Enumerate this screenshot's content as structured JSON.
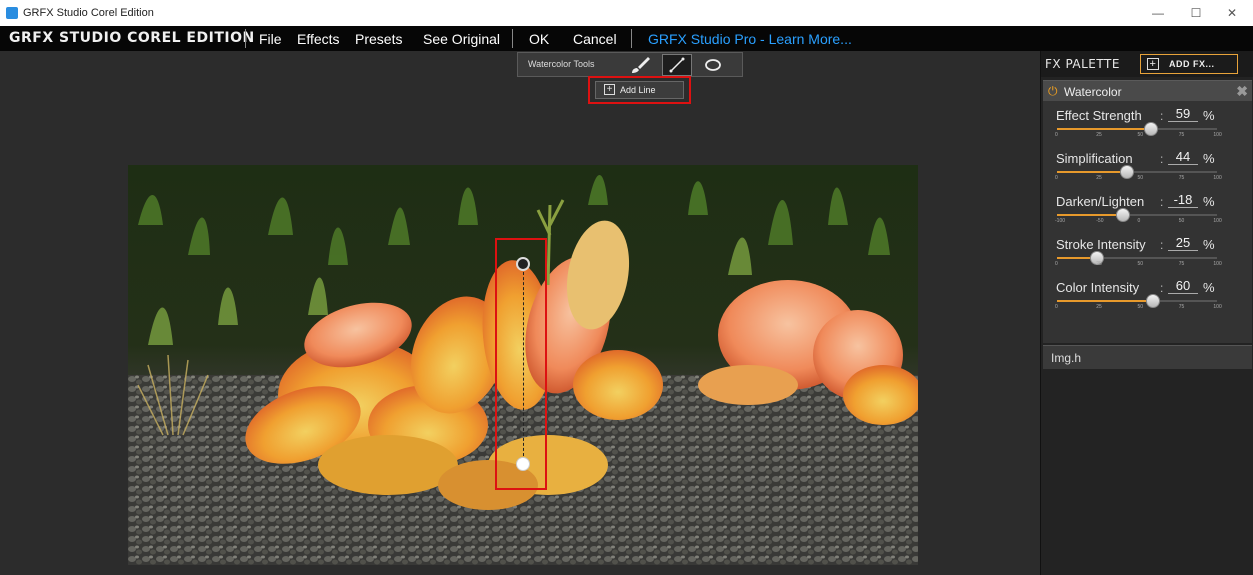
{
  "window": {
    "title": "GRFX Studio Corel Edition",
    "controls": [
      "—",
      "☐",
      "✕"
    ]
  },
  "menubar": {
    "logo": "GRFX STUDIO COREL EDITION",
    "items": [
      "File",
      "Effects",
      "Presets",
      "See Original"
    ],
    "ok": "OK",
    "cancel": "Cancel",
    "pro_link": "GRFX Studio Pro - Learn More..."
  },
  "tools": {
    "label": "Watercolor Tools",
    "icons": [
      "brush-icon",
      "line-icon",
      "ellipse-icon"
    ],
    "active": "line-icon"
  },
  "add_line": {
    "label": "Add Line"
  },
  "palette": {
    "title": "FX PALETTE",
    "add_fx": "ADD FX...",
    "effect": {
      "name": "Watercolor",
      "sliders": [
        {
          "label": "Effect Strength",
          "value": "59",
          "unit": "%",
          "fraction": 0.59,
          "ticks": [
            "0",
            "25",
            "50",
            "75",
            "100"
          ]
        },
        {
          "label": "Simplification",
          "value": "44",
          "unit": "%",
          "fraction": 0.44,
          "ticks": [
            "0",
            "25",
            "50",
            "75",
            "100"
          ]
        },
        {
          "label": "Darken/Lighten",
          "value": "-18",
          "unit": "%",
          "fraction": 0.41,
          "ticks": [
            "-100",
            "-50",
            "0",
            "50",
            "100"
          ]
        },
        {
          "label": "Stroke Intensity",
          "value": "25",
          "unit": "%",
          "fraction": 0.25,
          "ticks": [
            "0",
            "25",
            "50",
            "75",
            "100"
          ]
        },
        {
          "label": "Color Intensity",
          "value": "60",
          "unit": "%",
          "fraction": 0.6,
          "ticks": [
            "0",
            "25",
            "50",
            "75",
            "100"
          ]
        }
      ]
    },
    "img_section": "Img.h"
  },
  "colors": {
    "accent": "#e89a2c",
    "link": "#2aa0ff",
    "highlight": "#dd1111"
  }
}
